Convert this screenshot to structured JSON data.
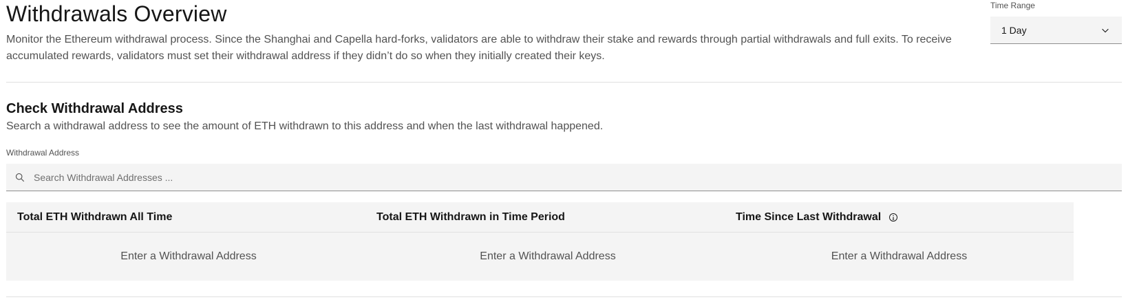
{
  "header": {
    "title": "Withdrawals Overview",
    "description": "Monitor the Ethereum withdrawal process. Since the Shanghai and Capella hard-forks, validators are able to withdraw their stake and rewards through partial withdrawals and full exits. To receive accumulated rewards, validators must set their withdrawal address if they didn’t do so when they initially created their keys."
  },
  "time_range": {
    "label": "Time Range",
    "selected": "1 Day",
    "icon": "chevron-down-icon"
  },
  "check_section": {
    "title": "Check Withdrawal Address",
    "description": "Search a withdrawal address to see the amount of ETH withdrawn to this address and when the last withdrawal happened.",
    "field_label": "Withdrawal Address",
    "search": {
      "placeholder": "Search Withdrawal Addresses ...",
      "value": "",
      "icon": "search-icon"
    }
  },
  "cards": [
    {
      "title": "Total ETH Withdrawn All Time",
      "value": "Enter a Withdrawal Address"
    },
    {
      "title": "Total ETH Withdrawn in Time Period",
      "value": "Enter a Withdrawal Address"
    },
    {
      "title": "Time Since Last Withdrawal",
      "value": "Enter a Withdrawal Address",
      "icon": "info-icon"
    }
  ],
  "colors": {
    "text_primary": "#161616",
    "text_secondary": "#525252",
    "field_bg": "#f4f4f4",
    "divider": "#e0e0e0"
  }
}
